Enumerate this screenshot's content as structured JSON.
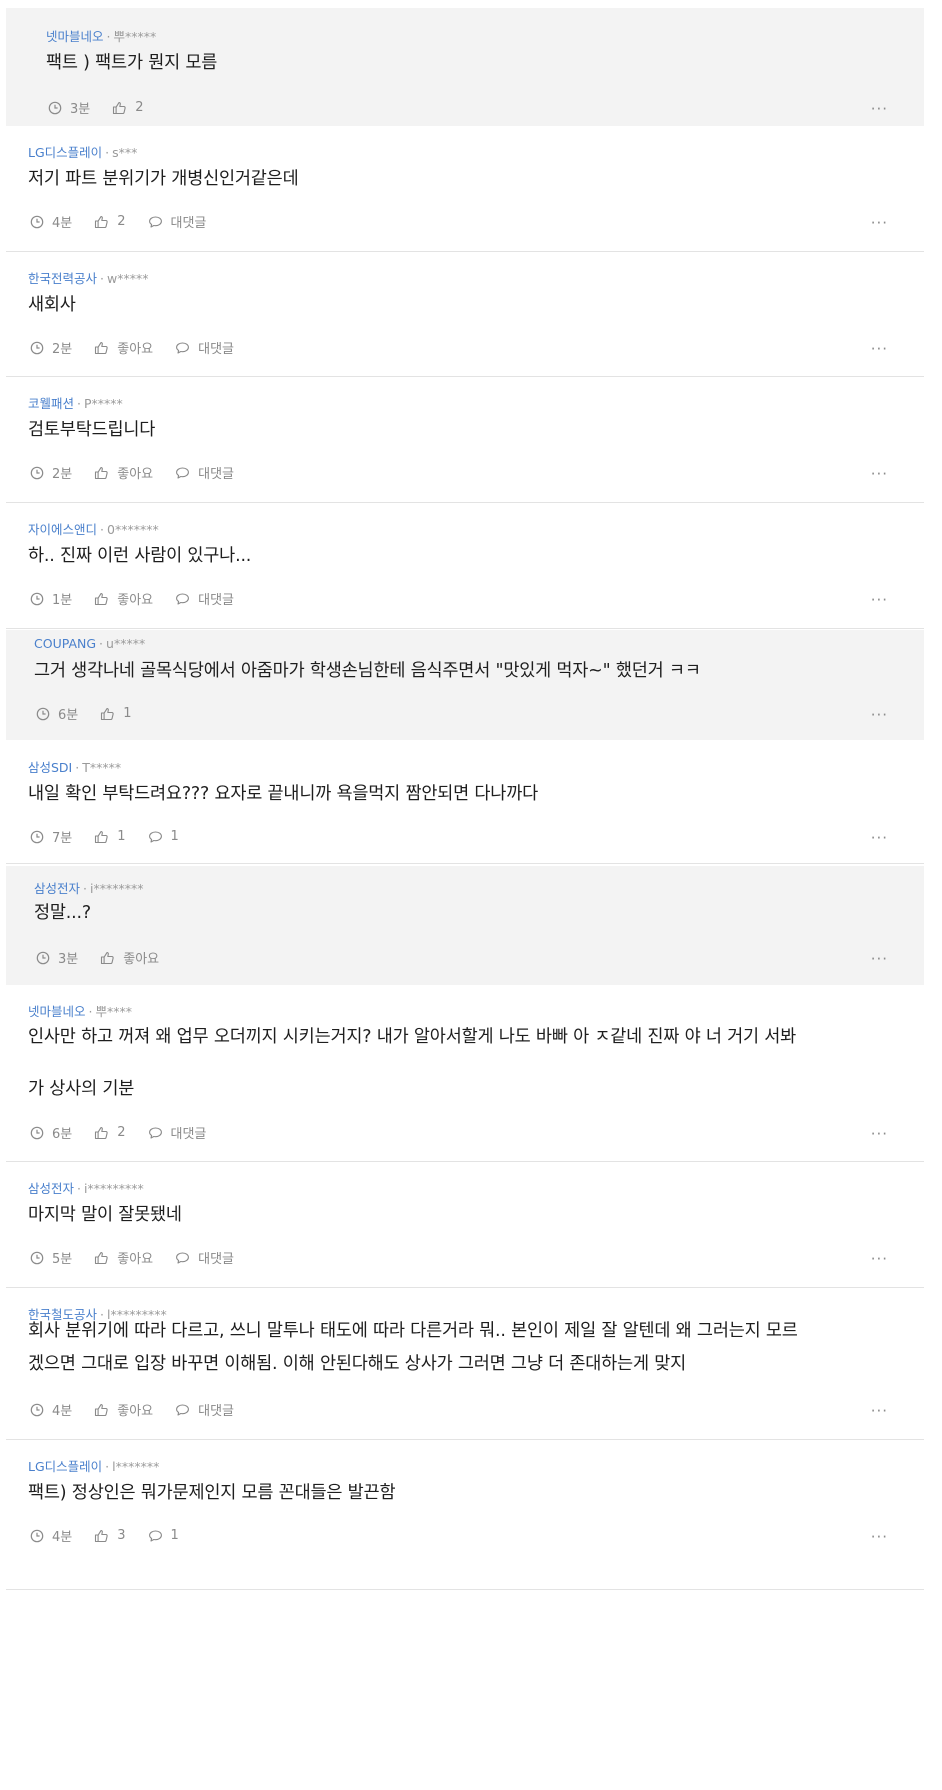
{
  "colors": {
    "company": "#4a80cc",
    "meta": "#9a9a9a",
    "reply_bg": "#f3f3f3"
  },
  "icons": {
    "time": "clock-icon",
    "like": "thumbs-up-icon",
    "reply": "speech-bubble-icon",
    "more": "ellipsis-icon"
  },
  "comments": [
    {
      "company": "넷마블네오",
      "user": "뿌*****",
      "body": "팩트 ) 팩트가 뭔지 모름",
      "time": "3분",
      "likes": "2",
      "reply": "",
      "more": "···"
    },
    {
      "company": "LG디스플레이",
      "user": "s***",
      "body": "저기 파트 분위기가 개병신인거같은데",
      "time": "4분",
      "likes": "2",
      "reply": "대댓글",
      "more": "···"
    },
    {
      "company": "한국전력공사",
      "user": "w*****",
      "body": "새회사",
      "time": "2분",
      "likes": "좋아요",
      "reply": "대댓글",
      "more": "···"
    },
    {
      "company": "코웰패션",
      "user": "P*****",
      "body": "검토부탁드립니다",
      "time": "2분",
      "likes": "좋아요",
      "reply": "대댓글",
      "more": "···"
    },
    {
      "company": "자이에스앤디",
      "user": "0*******",
      "body": "하.. 진짜 이런 사람이 있구나...",
      "time": "1분",
      "likes": "좋아요",
      "reply": "대댓글",
      "more": "···"
    },
    {
      "company": "COUPANG",
      "user": "u*****",
      "body": "그거 생각나네 골목식당에서 아줌마가 학생손님한테 음식주면서 \"맛있게 먹자~\" 했던거 ㅋㅋ",
      "time": "6분",
      "likes": "1",
      "reply": "",
      "more": "···"
    },
    {
      "company": "삼성SDI",
      "user": "T*****",
      "body": "내일 확인 부탁드려요??? 요자로 끝내니까 욕을먹지 짬안되면 다나까다",
      "time": "7분",
      "likes": "1",
      "reply": "1",
      "more": "···"
    },
    {
      "company": "삼성전자",
      "user": "i********",
      "body": "정말...?",
      "time": "3분",
      "likes": "좋아요",
      "reply": "",
      "more": "···"
    },
    {
      "company": "넷마블네오",
      "user": "뿌****",
      "body_lines": [
        "인사만 하고 꺼져 왜 업무 오더끼지 시키는거지? 내가 알아서할게 나도 바빠 아 ㅈ같네 진짜 야 너 거기 서봐",
        "",
        "가 상사의 기분"
      ],
      "time": "6분",
      "likes": "2",
      "reply": "대댓글",
      "more": "···"
    },
    {
      "company": "삼성전자",
      "user": "i*********",
      "body": "마지막 말이 잘못됐네",
      "time": "5분",
      "likes": "좋아요",
      "reply": "대댓글",
      "more": "···"
    },
    {
      "company": "한국철도공사",
      "user": "l*********",
      "body_lines": [
        "회사 분위기에 따라 다르고, 쓰니 말투나 태도에 따라 다른거라 뭐.. 본인이 제일 잘 알텐데 왜 그러는지 모르",
        "겠으면 그대로 입장 바꾸면 이해됨. 이해 안된다해도 상사가 그러면 그냥 더 존대하는게 맞지"
      ],
      "time": "4분",
      "likes": "좋아요",
      "reply": "대댓글",
      "more": "···"
    },
    {
      "company": "LG디스플레이",
      "user": "l*******",
      "body": "팩트) 정상인은 뭐가문제인지 모름 꼰대들은 발끈함",
      "time": "4분",
      "likes": "3",
      "reply": "1",
      "more": "···"
    }
  ]
}
